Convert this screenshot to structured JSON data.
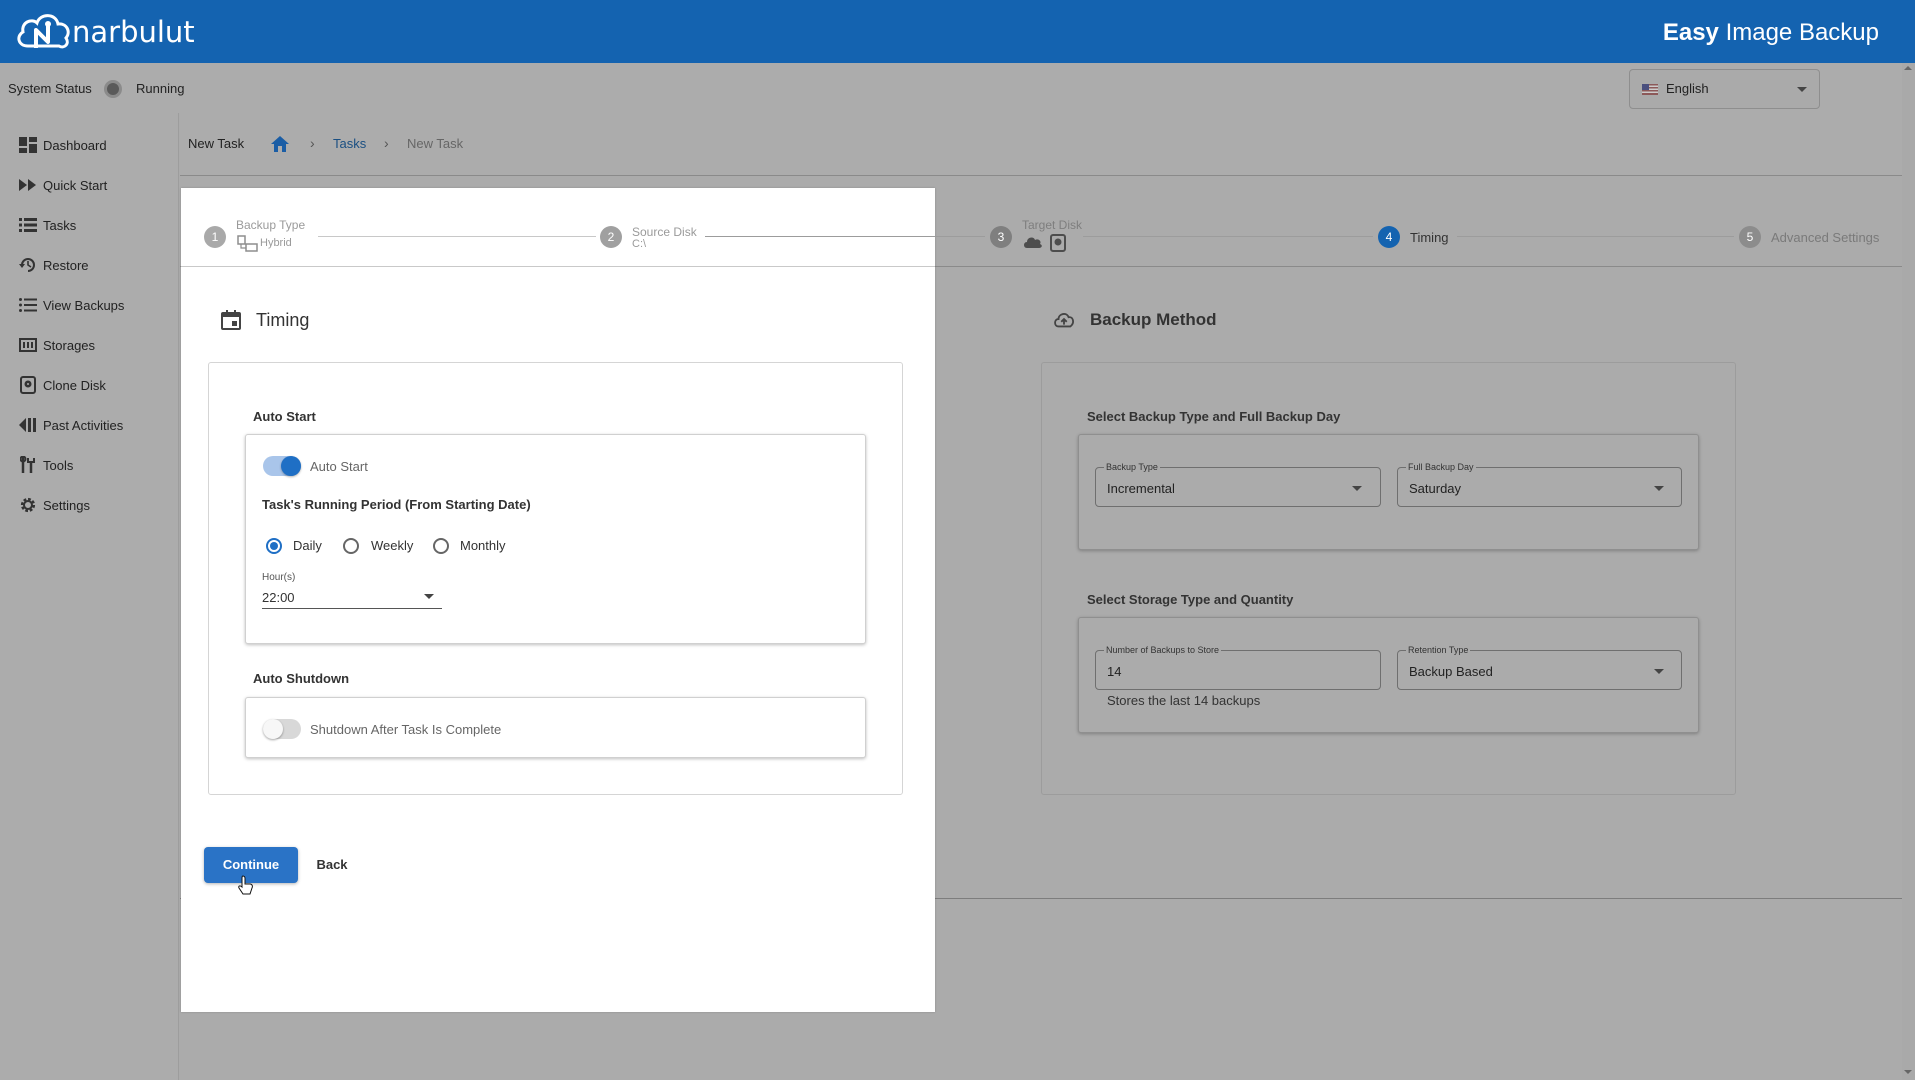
{
  "header": {
    "logo_text": "narbulut",
    "app_title_bold": "Easy",
    "app_title_rest": " Image Backup"
  },
  "status": {
    "label": "System Status",
    "value": "Running"
  },
  "language": {
    "selected": "English"
  },
  "sidebar": {
    "items": [
      {
        "label": "Dashboard",
        "icon": "dashboard-icon"
      },
      {
        "label": "Quick Start",
        "icon": "fast-forward-icon"
      },
      {
        "label": "Tasks",
        "icon": "list-icon"
      },
      {
        "label": "Restore",
        "icon": "restore-icon"
      },
      {
        "label": "View Backups",
        "icon": "list-bullets-icon"
      },
      {
        "label": "Storages",
        "icon": "storage-icon"
      },
      {
        "label": "Clone Disk",
        "icon": "disk-icon"
      },
      {
        "label": "Past Activities",
        "icon": "history-icon"
      },
      {
        "label": "Tools",
        "icon": "tools-icon"
      },
      {
        "label": "Settings",
        "icon": "gear-icon"
      }
    ]
  },
  "breadcrumb": {
    "page_title": "New Task",
    "link": "Tasks",
    "current": "New Task",
    "separator": "›"
  },
  "stepper": {
    "steps": [
      {
        "num": "1",
        "title": "Backup Type",
        "sub": "Hybrid"
      },
      {
        "num": "2",
        "title": "Source Disk",
        "sub": "C:\\"
      },
      {
        "num": "3",
        "title": "Target Disk",
        "sub": ""
      },
      {
        "num": "4",
        "title": "Timing",
        "sub": ""
      },
      {
        "num": "5",
        "title": "Advanced Settings",
        "sub": ""
      }
    ],
    "active_step": 4
  },
  "timing": {
    "title": "Timing",
    "auto_start_section": "Auto Start",
    "auto_start_toggle_label": "Auto Start",
    "auto_start_on": true,
    "running_period_label": "Task's Running Period (From Starting Date)",
    "period_options": [
      "Daily",
      "Weekly",
      "Monthly"
    ],
    "period_selected": "Daily",
    "hours_label": "Hour(s)",
    "hours_value": "22:00",
    "auto_shutdown_section": "Auto Shutdown",
    "shutdown_toggle_label": "Shutdown After Task Is Complete",
    "shutdown_on": false
  },
  "actions": {
    "continue_label": "Continue",
    "back_label": "Back"
  },
  "backup_method": {
    "title": "Backup Method",
    "type_section": "Select Backup Type and Full Backup Day",
    "backup_type_label": "Backup Type",
    "backup_type_value": "Incremental",
    "full_day_label": "Full Backup Day",
    "full_day_value": "Saturday",
    "storage_section": "Select Storage Type and Quantity",
    "num_backups_label": "Number of Backups to Store",
    "num_backups_value": "14",
    "retention_label": "Retention Type",
    "retention_value": "Backup Based",
    "helper_text": "Stores the last 14 backups"
  },
  "colors": {
    "brand": "#1463b0",
    "accent": "#1f6fc5",
    "overlay": "#ababab"
  }
}
